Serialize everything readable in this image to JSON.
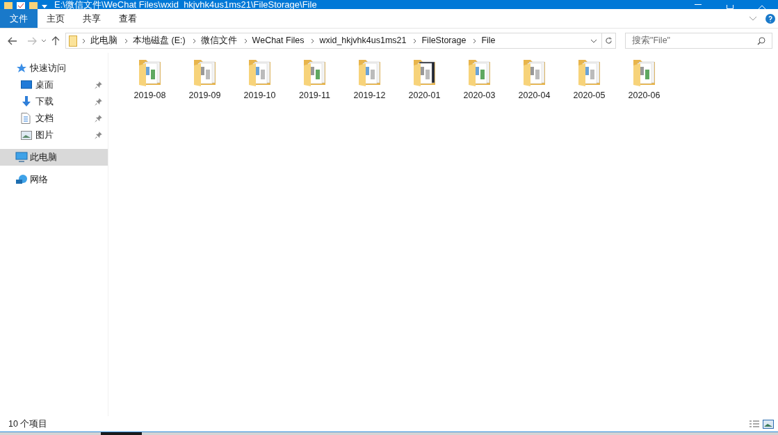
{
  "window": {
    "title": "E:\\微信文件\\WeChat Files\\wxid_hkjvhk4us1ms21\\FileStorage\\File"
  },
  "ribbon_tabs": [
    {
      "label": "文件",
      "selected": true
    },
    {
      "label": "主页",
      "selected": false
    },
    {
      "label": "共享",
      "selected": false
    },
    {
      "label": "查看",
      "selected": false
    }
  ],
  "breadcrumb": [
    "此电脑",
    "本地磁盘 (E:)",
    "微信文件",
    "WeChat Files",
    "wxid_hkjvhk4us1ms21",
    "FileStorage",
    "File"
  ],
  "search": {
    "placeholder": "搜索\"File\""
  },
  "sidebar": {
    "items": [
      {
        "label": "快速访问",
        "kind": "quick",
        "selected": false,
        "pinned": false,
        "children": [
          {
            "label": "桌面",
            "kind": "desktop",
            "selected": false,
            "pinned": true
          },
          {
            "label": "下载",
            "kind": "download",
            "selected": false,
            "pinned": true
          },
          {
            "label": "文档",
            "kind": "document",
            "selected": false,
            "pinned": true
          },
          {
            "label": "图片",
            "kind": "picture",
            "selected": false,
            "pinned": true
          }
        ]
      },
      {
        "label": "此电脑",
        "kind": "computer",
        "selected": true,
        "pinned": false
      },
      {
        "label": "网络",
        "kind": "network",
        "selected": false,
        "pinned": false
      }
    ]
  },
  "folders": [
    {
      "name": "2019-08"
    },
    {
      "name": "2019-09"
    },
    {
      "name": "2019-10"
    },
    {
      "name": "2019-11"
    },
    {
      "name": "2019-12"
    },
    {
      "name": "2020-01"
    },
    {
      "name": "2020-03"
    },
    {
      "name": "2020-04"
    },
    {
      "name": "2020-05"
    },
    {
      "name": "2020-06"
    }
  ],
  "status_bar": {
    "count": "10 个项目"
  }
}
